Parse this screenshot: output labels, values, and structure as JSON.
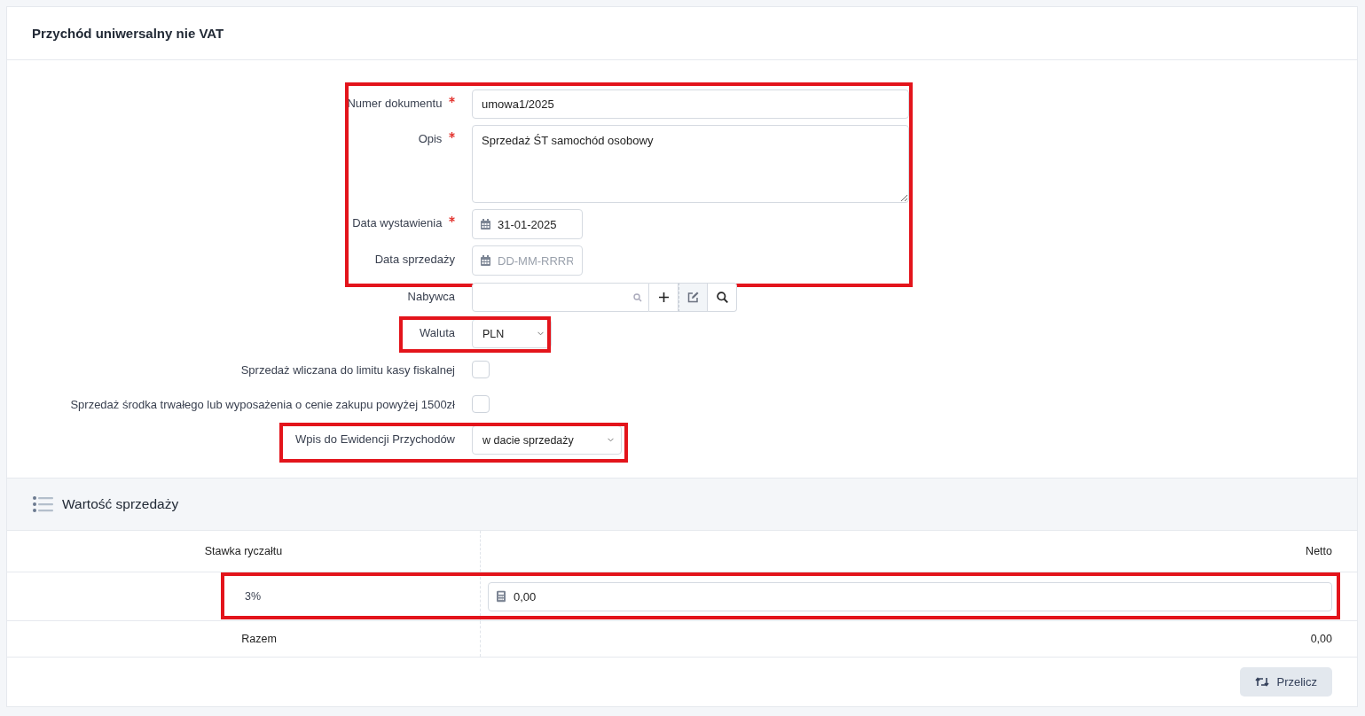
{
  "title": "Przychód uniwersalny nie VAT",
  "form_groups": [
    {
      "highlighted": true,
      "fields": [
        {
          "kind": "text",
          "label": "Numer dokumentu",
          "required": true,
          "value": "umowa1/2025"
        },
        {
          "kind": "textarea",
          "label": "Opis",
          "required": true,
          "value": "Sprzedaż ŚT samochód osobowy"
        },
        {
          "kind": "date",
          "label": "Data wystawienia",
          "required": true,
          "value": "31-01-2025"
        },
        {
          "kind": "date",
          "label": "Data sprzedaży",
          "required": false,
          "placeholder": "DD-MM-RRRR"
        }
      ]
    },
    {
      "highlighted": false,
      "fields": [
        {
          "kind": "lookup",
          "label": "Nabywca",
          "required": false
        }
      ]
    },
    {
      "highlighted": true,
      "fields": [
        {
          "kind": "select",
          "label": "Waluta",
          "required": false,
          "value": "PLN"
        }
      ]
    },
    {
      "highlighted": false,
      "fields": [
        {
          "kind": "checkbox",
          "label": "Sprzedaż wliczana do limitu kasy fiskalnej",
          "required": false,
          "checked": false
        },
        {
          "kind": "checkbox",
          "label": "Sprzedaż środka trwałego lub wyposażenia o cenie zakupu powyżej 1500zł",
          "required": false,
          "checked": false
        }
      ]
    },
    {
      "highlighted": true,
      "fields": [
        {
          "kind": "select",
          "label": "Wpis do Ewidencji Przychodów",
          "required": false,
          "value": "w dacie sprzedaży"
        }
      ]
    }
  ],
  "section": {
    "title": "Wartość sprzedaży",
    "columns": [
      "Stawka ryczałtu",
      "Netto"
    ],
    "rows": [
      {
        "rate": "3%",
        "netto": "0,00",
        "highlighted": true
      }
    ],
    "total": {
      "label": "Razem",
      "value": "0,00"
    },
    "button": "Przelicz"
  }
}
